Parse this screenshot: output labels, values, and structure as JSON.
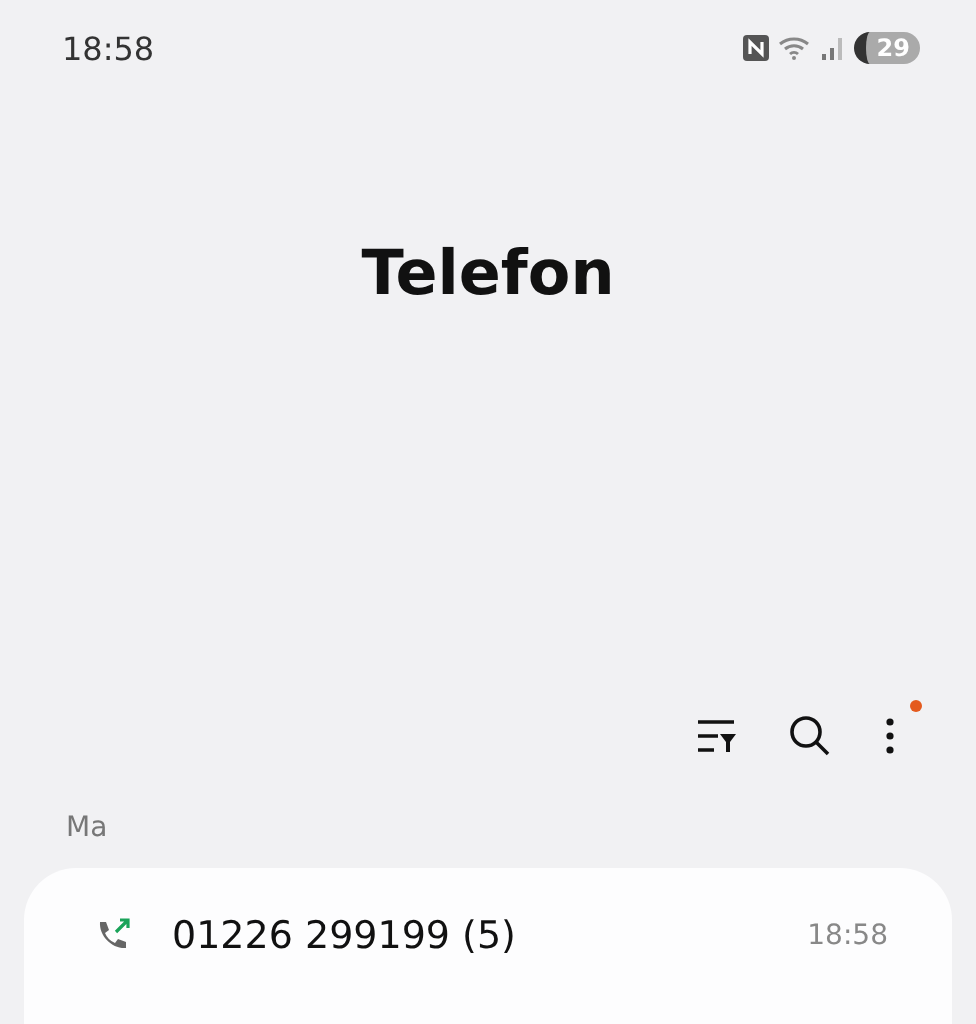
{
  "status_bar": {
    "time": "18:58",
    "battery": "29"
  },
  "title": "Telefon",
  "toolbar": {
    "menu_badge": true
  },
  "sections": [
    {
      "header": "Ma",
      "calls": [
        {
          "kind": "outgoing",
          "number": "01226 299199 (5)",
          "time": "18:58"
        }
      ]
    }
  ]
}
